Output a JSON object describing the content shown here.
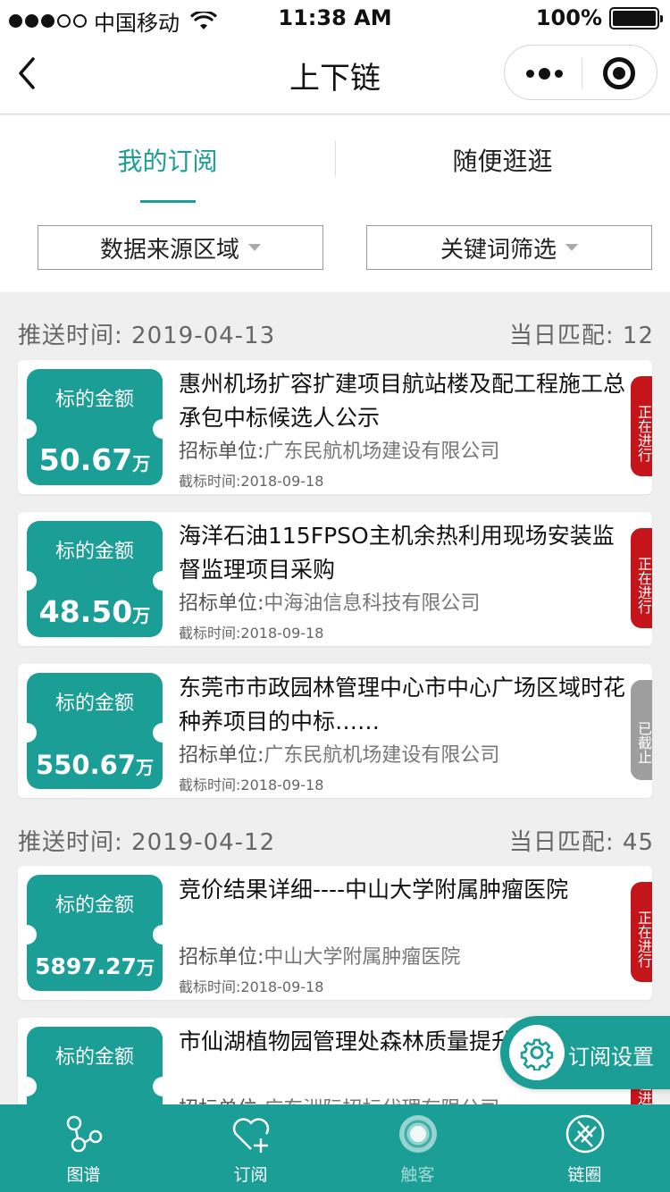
{
  "status_bar": {
    "carrier": "中国移动",
    "time": "11:38 AM",
    "battery": "100%"
  },
  "nav": {
    "title": "上下链"
  },
  "tabs": [
    {
      "label": "我的订阅",
      "active": true
    },
    {
      "label": "随便逛逛",
      "active": false
    }
  ],
  "filters": [
    {
      "label": "数据来源区域"
    },
    {
      "label": "关键词筛选"
    }
  ],
  "sections": [
    {
      "push_label": "推送时间:",
      "date": "2019-04-13",
      "match_label": "当日匹配:",
      "match_count": "12"
    },
    {
      "push_label": "推送时间:",
      "date": "2019-04-12",
      "match_label": "当日匹配:",
      "match_count": "45"
    }
  ],
  "cards": [
    {
      "amount_label": "标的金额",
      "amount": "50.67",
      "unit": "万",
      "title": "惠州机场扩容扩建项目航站楼及配工程施工总承包中标候选人公示",
      "org_label": "招标单位:",
      "org": "广东民航机场建设有限公司",
      "deadline_label": "截标时间:",
      "deadline": "2018-09-18",
      "status": "正在进行"
    },
    {
      "amount_label": "标的金额",
      "amount": "48.50",
      "unit": "万",
      "title": "海洋石油115FPSO主机余热利用现场安装监督监理项目采购",
      "org_label": "招标单位:",
      "org": "中海油信息科技有限公司",
      "deadline_label": "截标时间:",
      "deadline": "2018-09-18",
      "status": "正在进行"
    },
    {
      "amount_label": "标的金额",
      "amount": "550.67",
      "unit": "万",
      "title": "东莞市市政园林管理中心市中心广场区域时花种养项目的中标……",
      "org_label": "招标单位:",
      "org": "广东民航机场建设有限公司",
      "deadline_label": "截标时间:",
      "deadline": "2018-09-18",
      "status": "已截止"
    },
    {
      "amount_label": "标的金额",
      "amount": "5897.27",
      "unit": "万",
      "title": "竞价结果详细----中山大学附属肿瘤医院",
      "org_label": "招标单位:",
      "org": "中山大学附属肿瘤医院",
      "deadline_label": "截标时间:",
      "deadline": "2018-09-18",
      "status": "正在进行"
    },
    {
      "amount_label": "标的金额",
      "title": "市仙湖植物园管理处森林质量提升工程",
      "org_label": "招标单位:",
      "org": "广东洲际招标代理有限公司",
      "status": "正在进行"
    }
  ],
  "float_button": {
    "label": "订阅设置",
    "icon": "gear-icon"
  },
  "tabbar": [
    {
      "label": "图谱",
      "icon": "graph-icon"
    },
    {
      "label": "订阅",
      "icon": "heart-plus-icon"
    },
    {
      "label": "触客",
      "icon": "target-icon"
    },
    {
      "label": "链圈",
      "icon": "aperture-icon"
    }
  ],
  "colors": {
    "accent": "#1a9e96",
    "status_active": "#c4151b",
    "status_closed": "#9e9e9e"
  }
}
